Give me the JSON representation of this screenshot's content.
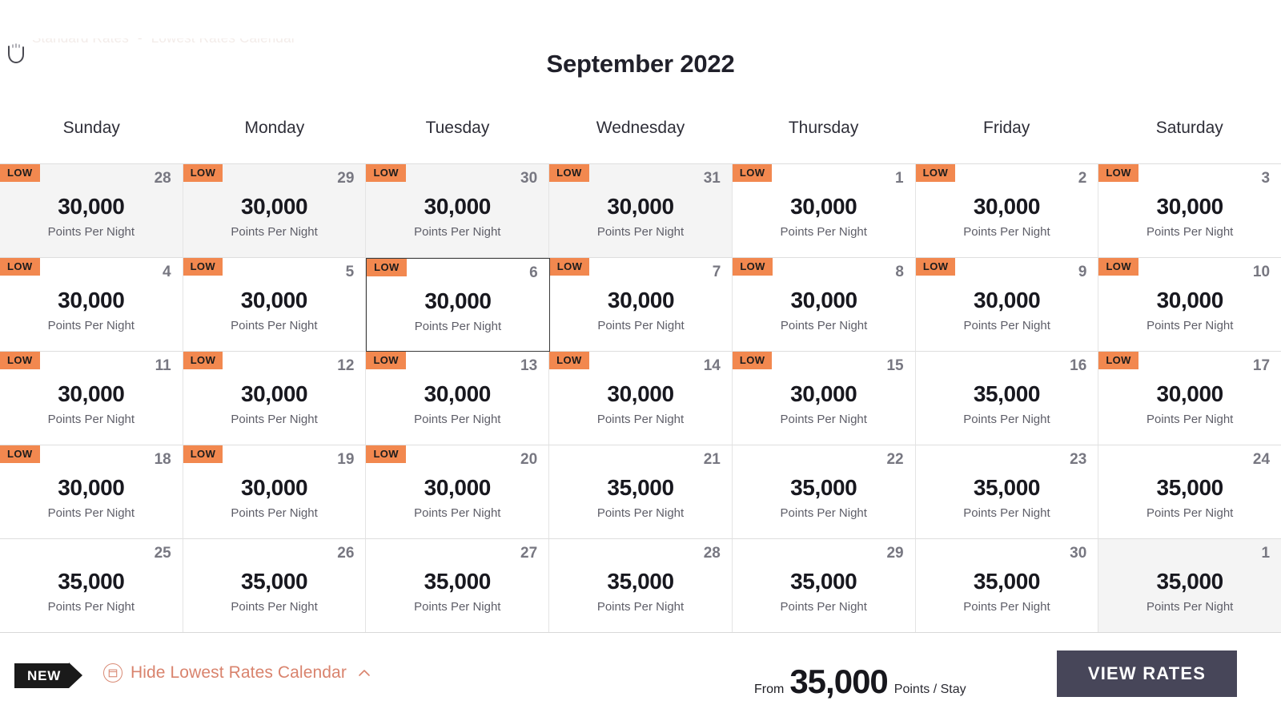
{
  "top_strip": {
    "left_text": "Standard Rates",
    "separator": "-",
    "right_text": "Lowest Rates Calendar"
  },
  "header": {
    "month_title": "September 2022"
  },
  "weekdays": [
    "Sunday",
    "Monday",
    "Tuesday",
    "Wednesday",
    "Thursday",
    "Friday",
    "Saturday"
  ],
  "labels": {
    "low_badge": "LOW",
    "points_per_night": "Points Per Night"
  },
  "colors": {
    "low_badge_bg": "#f2884f",
    "accent_link": "#d9836d",
    "view_rates_bg": "#474659",
    "muted_cell_bg": "#f4f4f4",
    "new_badge_bg": "#1a1a1a"
  },
  "weeks": [
    [
      {
        "day": "28",
        "points": "30,000",
        "low": true,
        "muted": true,
        "selected": false
      },
      {
        "day": "29",
        "points": "30,000",
        "low": true,
        "muted": true,
        "selected": false
      },
      {
        "day": "30",
        "points": "30,000",
        "low": true,
        "muted": true,
        "selected": false
      },
      {
        "day": "31",
        "points": "30,000",
        "low": true,
        "muted": true,
        "selected": false
      },
      {
        "day": "1",
        "points": "30,000",
        "low": true,
        "muted": false,
        "selected": false
      },
      {
        "day": "2",
        "points": "30,000",
        "low": true,
        "muted": false,
        "selected": false
      },
      {
        "day": "3",
        "points": "30,000",
        "low": true,
        "muted": false,
        "selected": false
      }
    ],
    [
      {
        "day": "4",
        "points": "30,000",
        "low": true,
        "muted": false,
        "selected": false
      },
      {
        "day": "5",
        "points": "30,000",
        "low": true,
        "muted": false,
        "selected": false
      },
      {
        "day": "6",
        "points": "30,000",
        "low": true,
        "muted": false,
        "selected": true
      },
      {
        "day": "7",
        "points": "30,000",
        "low": true,
        "muted": false,
        "selected": false
      },
      {
        "day": "8",
        "points": "30,000",
        "low": true,
        "muted": false,
        "selected": false
      },
      {
        "day": "9",
        "points": "30,000",
        "low": true,
        "muted": false,
        "selected": false
      },
      {
        "day": "10",
        "points": "30,000",
        "low": true,
        "muted": false,
        "selected": false
      }
    ],
    [
      {
        "day": "11",
        "points": "30,000",
        "low": true,
        "muted": false,
        "selected": false
      },
      {
        "day": "12",
        "points": "30,000",
        "low": true,
        "muted": false,
        "selected": false
      },
      {
        "day": "13",
        "points": "30,000",
        "low": true,
        "muted": false,
        "selected": false
      },
      {
        "day": "14",
        "points": "30,000",
        "low": true,
        "muted": false,
        "selected": false
      },
      {
        "day": "15",
        "points": "30,000",
        "low": true,
        "muted": false,
        "selected": false
      },
      {
        "day": "16",
        "points": "35,000",
        "low": false,
        "muted": false,
        "selected": false
      },
      {
        "day": "17",
        "points": "30,000",
        "low": true,
        "muted": false,
        "selected": false
      }
    ],
    [
      {
        "day": "18",
        "points": "30,000",
        "low": true,
        "muted": false,
        "selected": false
      },
      {
        "day": "19",
        "points": "30,000",
        "low": true,
        "muted": false,
        "selected": false
      },
      {
        "day": "20",
        "points": "30,000",
        "low": true,
        "muted": false,
        "selected": false
      },
      {
        "day": "21",
        "points": "35,000",
        "low": false,
        "muted": false,
        "selected": false
      },
      {
        "day": "22",
        "points": "35,000",
        "low": false,
        "muted": false,
        "selected": false
      },
      {
        "day": "23",
        "points": "35,000",
        "low": false,
        "muted": false,
        "selected": false
      },
      {
        "day": "24",
        "points": "35,000",
        "low": false,
        "muted": false,
        "selected": false
      }
    ],
    [
      {
        "day": "25",
        "points": "35,000",
        "low": false,
        "muted": false,
        "selected": false
      },
      {
        "day": "26",
        "points": "35,000",
        "low": false,
        "muted": false,
        "selected": false
      },
      {
        "day": "27",
        "points": "35,000",
        "low": false,
        "muted": false,
        "selected": false
      },
      {
        "day": "28",
        "points": "35,000",
        "low": false,
        "muted": false,
        "selected": false
      },
      {
        "day": "29",
        "points": "35,000",
        "low": false,
        "muted": false,
        "selected": false
      },
      {
        "day": "30",
        "points": "35,000",
        "low": false,
        "muted": false,
        "selected": false
      },
      {
        "day": "1",
        "points": "35,000",
        "low": false,
        "muted": true,
        "selected": false
      }
    ]
  ],
  "bottom_bar": {
    "new_badge": "NEW",
    "hide_toggle_label": "Hide Lowest Rates Calendar",
    "from_label": "From",
    "from_value": "35,000",
    "from_unit": "Points / Stay",
    "view_rates_label": "VIEW RATES"
  }
}
